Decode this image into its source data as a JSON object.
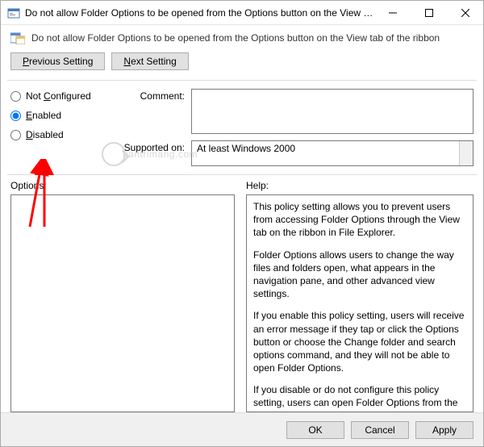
{
  "title": "Do not allow Folder Options to be opened from the Options button on the View tab of the ribbon",
  "headerText": "Do not allow Folder Options to be opened from the Options button on the View tab of the ribbon",
  "nav": {
    "prev": "Previous Setting",
    "next": "Next Setting"
  },
  "radios": {
    "notConfigured": "Not Configured",
    "enabled": "Enabled",
    "disabled": "Disabled",
    "selected": "enabled"
  },
  "labels": {
    "comment": "Comment:",
    "supported": "Supported on:",
    "options": "Options:",
    "help": "Help:"
  },
  "commentValue": "",
  "supportedValue": "At least Windows 2000",
  "help": {
    "p1": "This policy setting allows you to prevent users from accessing Folder Options through the View tab on the ribbon in File Explorer.",
    "p2": "Folder Options allows users to change the way files and folders open, what appears in the navigation pane, and other advanced view settings.",
    "p3": "If you enable this policy setting, users will receive an error message if they tap or click the Options button or choose the Change folder and search options command, and they will not be able to open Folder Options.",
    "p4": "If you disable or do not configure this policy setting, users can open Folder Options from the View tab on the ribbon."
  },
  "buttons": {
    "ok": "OK",
    "cancel": "Cancel",
    "apply": "Apply"
  },
  "watermark": "uantrimang"
}
